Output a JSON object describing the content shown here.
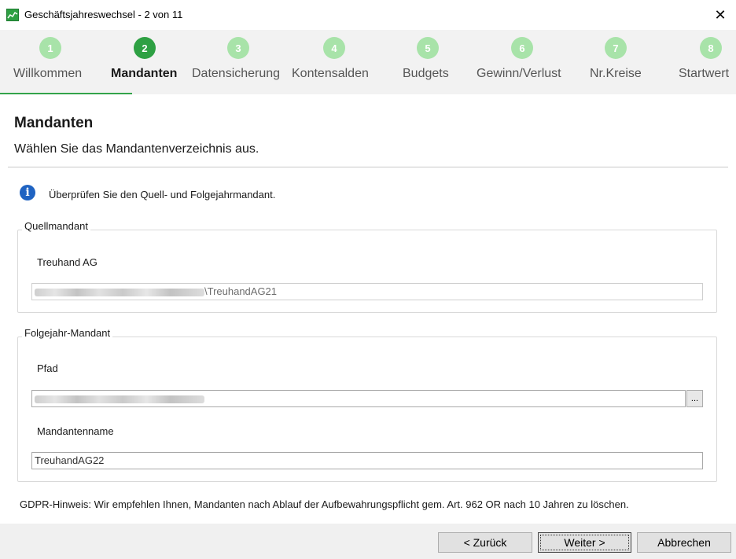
{
  "window": {
    "title": "Geschäftsjahreswechsel - 2 von 11",
    "close_glyph": "✕"
  },
  "steps": [
    {
      "num": "1",
      "label": "Willkommen",
      "active": false
    },
    {
      "num": "2",
      "label": "Mandanten",
      "active": true
    },
    {
      "num": "3",
      "label": "Datensicherung",
      "active": false
    },
    {
      "num": "4",
      "label": "Kontensalden",
      "active": false
    },
    {
      "num": "5",
      "label": "Budgets",
      "active": false
    },
    {
      "num": "6",
      "label": "Gewinn/Verlust",
      "active": false
    },
    {
      "num": "7",
      "label": "Nr.Kreise",
      "active": false
    },
    {
      "num": "8",
      "label": "Startwert",
      "active": false
    }
  ],
  "page": {
    "title": "Mandanten",
    "subtitle": "Wählen Sie das Mandantenverzeichnis aus.",
    "info": "Überprüfen Sie den Quell- und Folgejahrmandant."
  },
  "source": {
    "legend": "Quellmandant",
    "name": "Treuhand AG",
    "path_suffix": "\\TreuhandAG21"
  },
  "target": {
    "legend": "Folgejahr-Mandant",
    "path_label": "Pfad",
    "browse_label": "...",
    "name_label": "Mandantenname",
    "name_value": "TreuhandAG22"
  },
  "gdpr": "GDPR-Hinweis: Wir empfehlen Ihnen, Mandanten nach Ablauf der Aufbewahrungspflicht  gem. Art. 962 OR nach 10 Jahren zu löschen.",
  "buttons": {
    "back": "< Zurück",
    "next": "Weiter >",
    "cancel": "Abbrechen"
  },
  "colors": {
    "accent": "#2ea043",
    "step_inactive": "#a8e3a9",
    "info": "#1f63c2"
  }
}
